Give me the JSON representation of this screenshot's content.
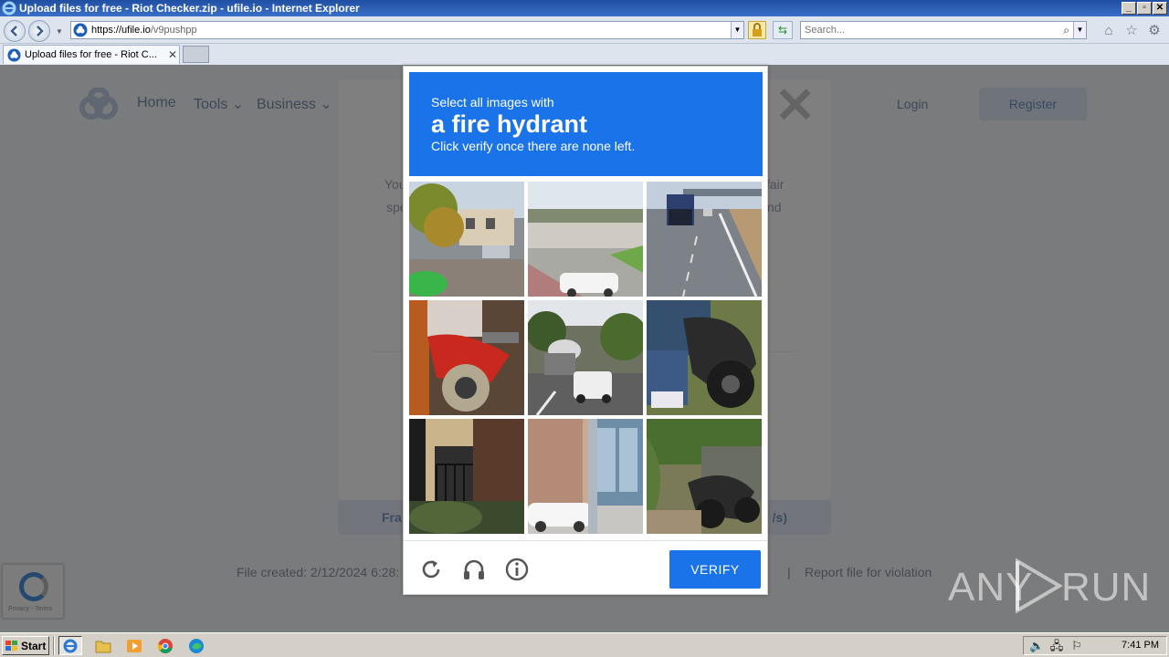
{
  "window": {
    "title": "Upload files for free - Riot Checker.zip - ufile.io - Internet Explorer",
    "controls": [
      "_",
      "▫",
      "✕"
    ]
  },
  "addressbar": {
    "url_host": "https://ufile.io",
    "url_path": "/v9pushpp",
    "search_placeholder": "Search..."
  },
  "tabs": [
    {
      "title": "Upload files for free - Riot C...",
      "close": "✕"
    }
  ],
  "site": {
    "nav": [
      {
        "label": "Home"
      },
      {
        "label": "Tools ⌄"
      },
      {
        "label": "Business ⌄"
      }
    ],
    "login_label": "Login",
    "register_label": "Register",
    "modal_text": [
      "You",
      "fair",
      "spe",
      "nd"
    ],
    "download_left": "Fra",
    "download_right": "/s)",
    "footer_created": "File created: 2/12/2024 6:28:",
    "footer_report": "Report file for violation",
    "footer_sep": "|",
    "recaptcha_text": "Privacy - Terms"
  },
  "captcha": {
    "instruction_pre": "Select all images with",
    "target": "a fire hydrant",
    "instruction_post": "Click verify once there are none left.",
    "verify_label": "VERIFY",
    "tiles": [
      {
        "subject": "street with houses and trees"
      },
      {
        "subject": "highway underpass with white car"
      },
      {
        "subject": "highway with truck"
      },
      {
        "subject": "red motorcycle close-up"
      },
      {
        "subject": "street with cement truck and cars"
      },
      {
        "subject": "person on scooter"
      },
      {
        "subject": "building entrance with railing"
      },
      {
        "subject": "building with parked car and pole"
      },
      {
        "subject": "motorcycle in grass"
      }
    ]
  },
  "watermark": {
    "left": "ANY",
    "right": "RUN"
  },
  "taskbar": {
    "start_label": "Start",
    "clock": "7:41 PM"
  },
  "colors": {
    "captcha_blue": "#1a73e8",
    "title_blue": "#1f4fa3"
  }
}
